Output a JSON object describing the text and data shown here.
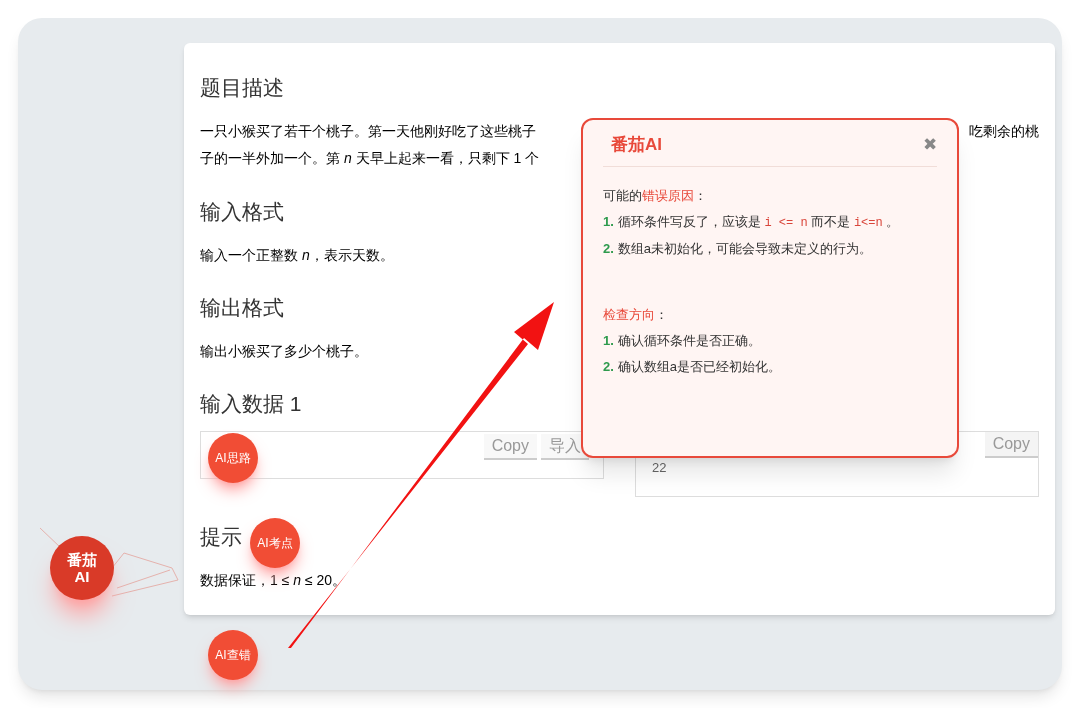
{
  "problem": {
    "sections": [
      {
        "kind": "description",
        "heading": "题目描述",
        "lines": [
          "一只小猴买了若干个桃子。第一天他刚好吃了这些桃子",
          "子的一半外加一个。第 *n* 天早上起来一看，只剩下 1 个"
        ],
        "peek": "吃剩余的桃"
      },
      {
        "kind": "text",
        "heading": "输入格式",
        "body": "输入一个正整数 *n*，表示天数。"
      },
      {
        "kind": "text",
        "heading": "输出格式",
        "body": "输出小猴买了多少个桃子。"
      },
      {
        "kind": "samples",
        "heading": "输入数据 1",
        "input_buttons": [
          "Copy",
          "导入"
        ],
        "output_value": "22",
        "output_buttons": [
          "Copy"
        ]
      },
      {
        "kind": "text",
        "heading": "提示",
        "body": "数据保证，1 ≤ *n* ≤ 20。"
      }
    ]
  },
  "ai_panel": {
    "title": "番茄AI",
    "close": "✖",
    "groups": [
      {
        "lead": "可能的",
        "highlight": "错误原因",
        "tail": "：",
        "items": [
          {
            "number": "1.",
            "segments": [
              {
                "kind": "text",
                "text": "循环条件写反了，应该是 "
              },
              {
                "kind": "code",
                "text": "i <= n"
              },
              {
                "kind": "text",
                "text": " 而不是 "
              },
              {
                "kind": "code",
                "text": "i<=n"
              },
              {
                "kind": "text",
                "text": " 。"
              }
            ]
          },
          {
            "number": "2.",
            "segments": [
              {
                "kind": "text",
                "text": "数组a未初始化，可能会导致未定义的行为。"
              }
            ]
          }
        ]
      },
      {
        "highlight": "检查方向",
        "tail": "：",
        "items": [
          {
            "number": "1.",
            "segments": [
              {
                "kind": "text",
                "text": "确认循环条件是否正确。"
              }
            ]
          },
          {
            "number": "2.",
            "segments": [
              {
                "kind": "text",
                "text": "确认数组a是否已经初始化。"
              }
            ]
          }
        ]
      }
    ]
  },
  "bubbles": [
    {
      "label": "AI思路"
    },
    {
      "label": "AI考点"
    },
    {
      "label": "AI查错"
    }
  ],
  "main_bubble": {
    "lines": [
      "番茄",
      "AI"
    ]
  }
}
